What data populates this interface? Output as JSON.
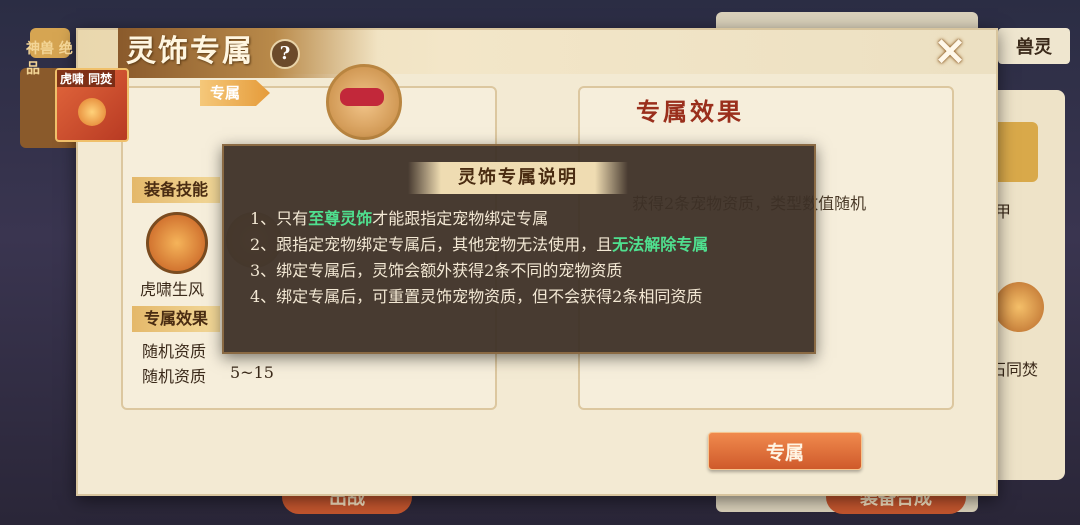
{
  "background": {
    "right_tab": "兽灵",
    "right_item_1_suffix": "甲",
    "right_item_2_label": "石同焚",
    "bottom_left_button": "出战",
    "bottom_right_button": "装备合成",
    "left_emblem": "神兽 绝品"
  },
  "panel": {
    "title": "灵饰专属",
    "help_label": "?",
    "close_label": "✕",
    "item_tag": "虎啸 同焚",
    "arrow_label": "专属",
    "equip_skill_label": "装备技能",
    "skill_name": "虎啸生风",
    "exclusive_effect_label": "专属效果",
    "random_quality_1": "随机资质",
    "random_quality_2": "随机资质",
    "random_quality_2_range": "5~15",
    "right_title": "专属效果",
    "right_desc": "获得2条宠物资质，类型数值随机",
    "confirm_button": "专属"
  },
  "modal": {
    "title": "灵饰专属说明",
    "line1_pre": "1、只有",
    "line1_hl": "至尊灵饰",
    "line1_post": "才能跟指定宠物绑定专属",
    "line2_pre": "2、跟指定宠物绑定专属后，其他宠物无法使用，且",
    "line2_hl": "无法解除专属",
    "line3": "3、绑定专属后，灵饰会额外获得2条不同的宠物资质",
    "line4": "4、绑定专属后，可重置灵饰宠物资质，但不会获得2条相同资质"
  },
  "colors": {
    "highlight": "#4fe08f",
    "button": "#cf5a2b",
    "title_red": "#9a2f1c"
  }
}
